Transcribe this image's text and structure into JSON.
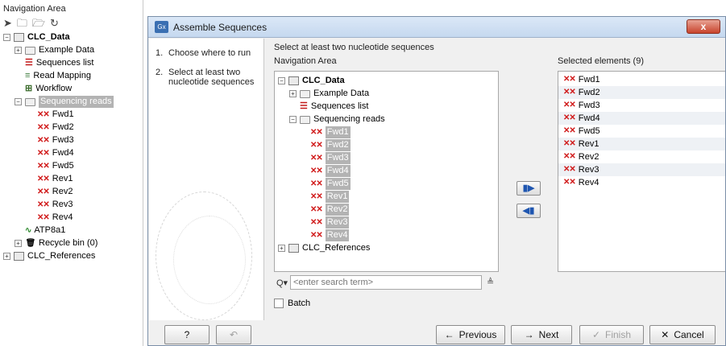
{
  "nav": {
    "title": "Navigation Area",
    "tree": [
      {
        "label": "CLC_Data"
      },
      {
        "label": "Example Data"
      },
      {
        "label": "Sequences list"
      },
      {
        "label": "Read Mapping"
      },
      {
        "label": "Workflow"
      },
      {
        "label": "Sequencing reads"
      },
      {
        "label": "Fwd1"
      },
      {
        "label": "Fwd2"
      },
      {
        "label": "Fwd3"
      },
      {
        "label": "Fwd4"
      },
      {
        "label": "Fwd5"
      },
      {
        "label": "Rev1"
      },
      {
        "label": "Rev2"
      },
      {
        "label": "Rev3"
      },
      {
        "label": "Rev4"
      },
      {
        "label": "ATP8a1"
      },
      {
        "label": "Recycle bin (0)"
      },
      {
        "label": "CLC_References"
      }
    ]
  },
  "dialog": {
    "logo": "Gx",
    "title": "Assemble Sequences",
    "close": "x",
    "steps": [
      {
        "num": "1.",
        "text": "Choose where to run"
      },
      {
        "num": "2.",
        "text": "Select at least two nucleotide sequences"
      }
    ],
    "hint": "Select at least two nucleotide sequences",
    "nav_label": "Navigation Area",
    "selected_label": "Selected elements (9)",
    "source_tree": [
      {
        "label": "CLC_Data"
      },
      {
        "label": "Example Data"
      },
      {
        "label": "Sequences list"
      },
      {
        "label": "Sequencing reads"
      },
      {
        "label": "Fwd1"
      },
      {
        "label": "Fwd2"
      },
      {
        "label": "Fwd3"
      },
      {
        "label": "Fwd4"
      },
      {
        "label": "Fwd5"
      },
      {
        "label": "Rev1"
      },
      {
        "label": "Rev2"
      },
      {
        "label": "Rev3"
      },
      {
        "label": "Rev4"
      },
      {
        "label": "CLC_References"
      }
    ],
    "selected": [
      "Fwd1",
      "Fwd2",
      "Fwd3",
      "Fwd4",
      "Fwd5",
      "Rev1",
      "Rev2",
      "Rev3",
      "Rev4"
    ],
    "search_placeholder": "<enter search term>",
    "batch_label": "Batch",
    "buttons": {
      "help": "?",
      "previous": "Previous",
      "next": "Next",
      "finish": "Finish",
      "cancel": "Cancel"
    }
  },
  "colors": {
    "seq_icon": "#d01818",
    "selection": "#b3b3b3",
    "title_bar": "#c5d8ef",
    "close": "#c8432c"
  }
}
